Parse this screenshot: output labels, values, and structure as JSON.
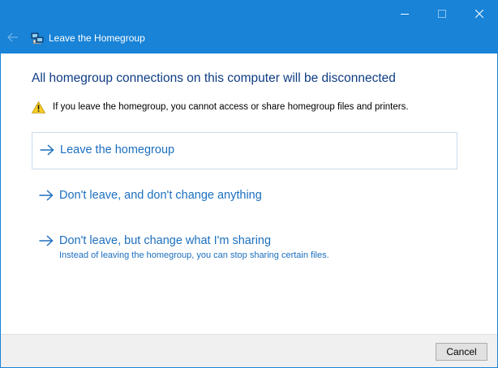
{
  "window": {
    "title": "Leave the Homegroup",
    "colors": {
      "titlebar": "#1883d7",
      "link": "#1c6fbf",
      "heading": "#0f3c84"
    }
  },
  "titlebar": {
    "controls": [
      "minimize-icon",
      "maximize-icon",
      "close-icon"
    ],
    "back_icon": "back-arrow-icon",
    "app_icon": "homegroup-icon"
  },
  "main": {
    "heading": "All homegroup connections on this computer will be disconnected",
    "warning": {
      "icon": "warning-icon",
      "text": "If you leave the homegroup, you cannot access or share homegroup files and printers."
    },
    "options": [
      {
        "label": "Leave the homegroup",
        "icon": "arrow-right-icon"
      },
      {
        "label": "Don't leave, and don't change anything",
        "icon": "arrow-right-icon"
      },
      {
        "label": "Don't leave, but change what I'm sharing",
        "sublabel": "Instead of leaving the homegroup, you can stop sharing certain files.",
        "icon": "arrow-right-icon"
      }
    ]
  },
  "footer": {
    "cancel_label": "Cancel"
  }
}
